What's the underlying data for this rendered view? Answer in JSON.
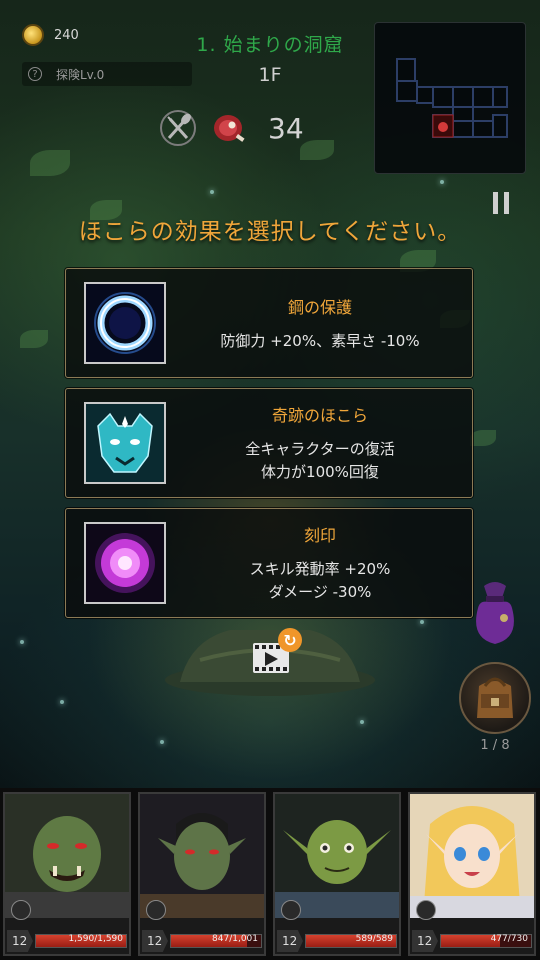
{
  "hud": {
    "gold": "240",
    "explore_level": "探険Lv.0",
    "dungeon_name": "1. 始まりの洞窟",
    "floor": "1F",
    "food_count": "34"
  },
  "prompt": "ほこらの効果を選択してください。",
  "options": [
    {
      "title": "鋼の保護",
      "desc": "防御力 +20%、素早さ -10%",
      "icon": "blue-ring-icon"
    },
    {
      "title": "奇跡のほこら",
      "desc": "全キャラクターの復活\n体力が100%回復",
      "icon": "spirit-tiger-icon"
    },
    {
      "title": "刻印",
      "desc": "スキル発動率 +20%\nダメージ -30%",
      "icon": "purple-orb-icon"
    }
  ],
  "inventory": {
    "count": "1 / 8"
  },
  "party": [
    {
      "level": "12",
      "hp": "1,590/1,590",
      "hp_fraction": 1.0,
      "class_icon": "shield-icon"
    },
    {
      "level": "12",
      "hp": "847/1,001",
      "hp_fraction": 0.846,
      "class_icon": "sword-icon"
    },
    {
      "level": "12",
      "hp": "589/589",
      "hp_fraction": 1.0,
      "class_icon": "dagger-icon"
    },
    {
      "level": "12",
      "hp": "477/730",
      "hp_fraction": 0.653,
      "class_icon": "hat-icon"
    }
  ],
  "colors": {
    "accent_orange": "#f0a63a",
    "dungeon_green": "#2fa84a",
    "hp_red": "#c0301f"
  }
}
